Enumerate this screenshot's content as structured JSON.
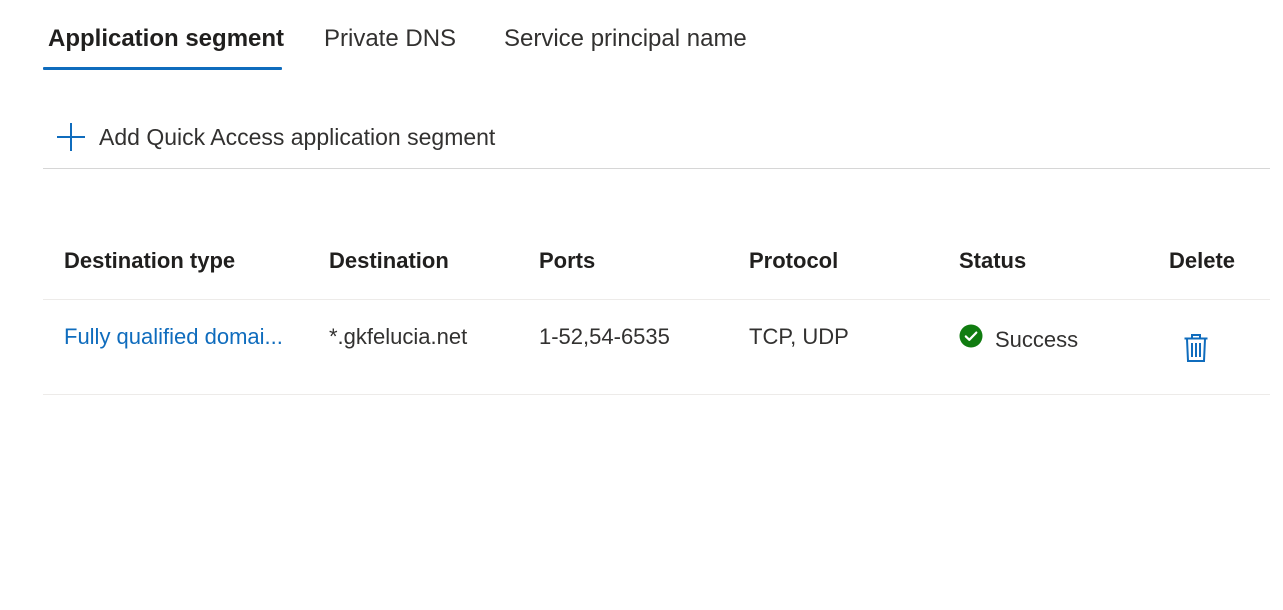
{
  "tabs": [
    {
      "label": "Application segment",
      "active": true
    },
    {
      "label": "Private DNS",
      "active": false
    },
    {
      "label": "Service principal name",
      "active": false
    }
  ],
  "toolbar": {
    "add_icon": "plus-icon",
    "add_label": "Add Quick Access application segment"
  },
  "table": {
    "columns": [
      "Destination type",
      "Destination",
      "Ports",
      "Protocol",
      "Status",
      "Delete"
    ],
    "rows": [
      {
        "destination_type": "Fully qualified domai...",
        "destination": "*.gkfelucia.net",
        "ports": "1-52,54-6535",
        "protocol": "TCP, UDP",
        "status": "Success",
        "status_icon": "check-circle-icon",
        "delete_icon": "trash-icon"
      }
    ]
  },
  "colors": {
    "accent": "#0f6cbd",
    "success": "#107c10",
    "text": "#323130"
  }
}
